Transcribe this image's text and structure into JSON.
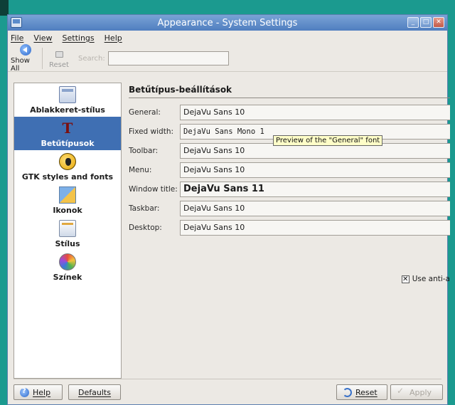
{
  "window": {
    "title": "Appearance - System Settings",
    "buttons": [
      "_",
      "□",
      "✕"
    ]
  },
  "menubar": {
    "items": [
      "File",
      "View",
      "Settings",
      "Help"
    ]
  },
  "toolbar": {
    "show_all_label": "Show All",
    "reset_label": "Reset",
    "search_label": "Search:",
    "search_value": ""
  },
  "sidebar": {
    "items": [
      {
        "label": "Ablakkeret-stílus",
        "icon": "window-decoration-icon",
        "active": false
      },
      {
        "label": "Betűtípusok",
        "icon": "fonts-icon",
        "active": true
      },
      {
        "label": "GTK styles and fonts",
        "icon": "gtk-icon",
        "active": false
      },
      {
        "label": "Ikonok",
        "icon": "icons-icon",
        "active": false
      },
      {
        "label": "Stílus",
        "icon": "style-icon",
        "active": false
      },
      {
        "label": "Színek",
        "icon": "colors-icon",
        "active": false
      }
    ]
  },
  "main": {
    "title": "Betűtípus-beállítások",
    "rows": [
      {
        "label": "General:",
        "value": "DejaVu Sans 10"
      },
      {
        "label": "Fixed width:",
        "value": "DejaVu Sans Mono 1"
      },
      {
        "label": "Toolbar:",
        "value": "DejaVu Sans 10"
      },
      {
        "label": "Menu:",
        "value": "DejaVu Sans 10"
      },
      {
        "label": "Window title:",
        "value": "DejaVu Sans 11"
      },
      {
        "label": "Taskbar:",
        "value": "DejaVu Sans 10"
      },
      {
        "label": "Desktop:",
        "value": "DejaVu Sans 10"
      }
    ],
    "tooltip": "Preview of the \"General\" font",
    "antialias": {
      "checked": true,
      "label": "Use anti-a"
    }
  },
  "bottom": {
    "help_label": "Help",
    "defaults_label": "Defaults",
    "reset_label": "Reset",
    "apply_label": "Apply"
  },
  "colors": {
    "desktop": "#1b9a8f",
    "titlebar": "#4f7ec0",
    "selection": "#3f6fb3",
    "window_bg": "#ece9e4"
  }
}
